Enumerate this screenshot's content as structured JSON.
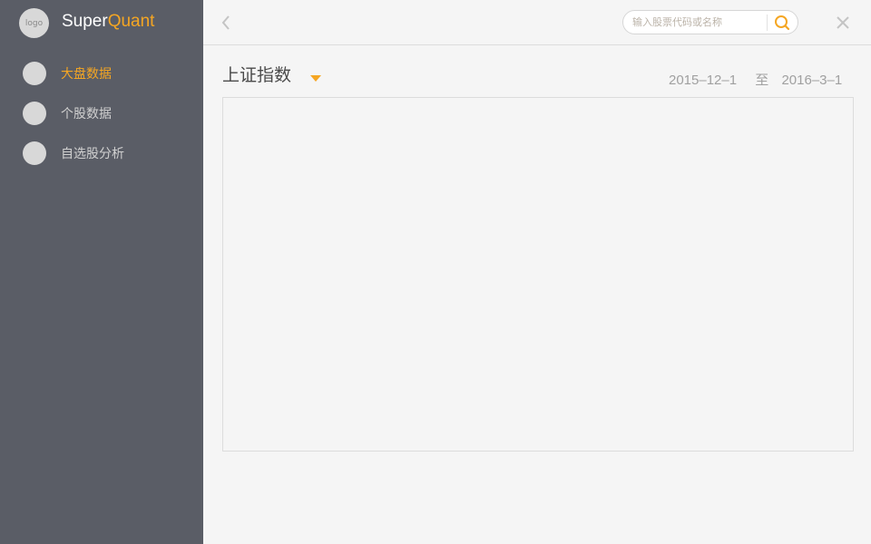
{
  "brand": {
    "logo_text": "logo",
    "name_part1": "Super",
    "name_part2": "Quant"
  },
  "sidebar": {
    "items": [
      {
        "label": "大盘数据",
        "active": true
      },
      {
        "label": "个股数据",
        "active": false
      },
      {
        "label": "自选股分析",
        "active": false
      }
    ]
  },
  "topbar": {
    "back_icon": "chevron-left-icon",
    "search": {
      "placeholder": "输入股票代码或名称",
      "value": "",
      "icon": "search-icon"
    },
    "close_icon": "close-icon"
  },
  "main": {
    "index_title": "上证指数",
    "dropdown_icon": "caret-down-icon",
    "date_from": "2015–12–1",
    "date_sep": "至",
    "date_to": "2016–3–1"
  },
  "colors": {
    "sidebar_bg": "#5A5D66",
    "accent": "#F5A623",
    "page_bg": "#F5F5F5",
    "placeholder": "#BBB3A8",
    "date_text": "#5F636C"
  }
}
